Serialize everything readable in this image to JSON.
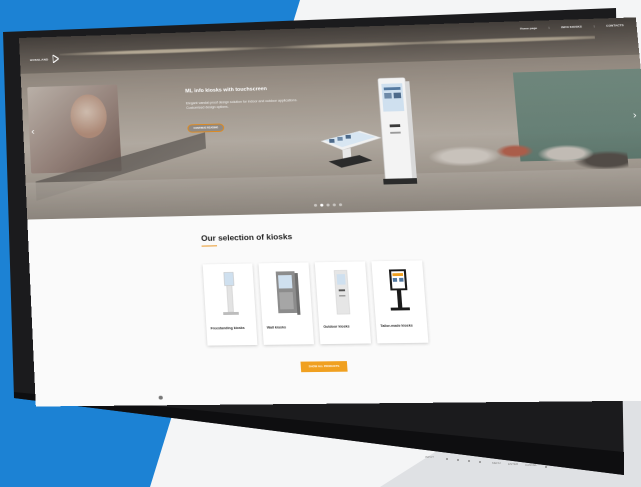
{
  "hero": {
    "logo_text": "HOSSLAND",
    "title": "ML info kiosks with touchscreen",
    "description": "Elegant vandal-proof design solution for indoor and outdoor applications. Customised design options.",
    "cta_label": "CONTINUE READING",
    "slide_count": 5,
    "active_slide": 2
  },
  "nav": {
    "items": [
      {
        "label": "Home page",
        "type": "link"
      },
      {
        "label": "INFO KIOSKS",
        "type": "link"
      },
      {
        "label": "CONTACTS",
        "type": "link"
      }
    ],
    "separator": "|"
  },
  "section": {
    "title": "Our selection of kiosks",
    "cards": [
      {
        "label": "Freestanding kiosks"
      },
      {
        "label": "Wall kiosks"
      },
      {
        "label": "Outdoor kiosks"
      },
      {
        "label": "Tailor-made kiosks"
      }
    ],
    "all_products_label": "SHOW ALL PRODUCTS"
  },
  "bezel": {
    "controls": [
      "INPUT",
      "MENU",
      "ENTER",
      "CANCEL"
    ]
  },
  "colors": {
    "accent": "#f0a020",
    "background_blue": "#1c82d4",
    "bezel": "#1b1b1d"
  },
  "icons": {
    "prev": "chevron-left-icon",
    "next": "chevron-right-icon",
    "logo": "logo-triangle-icon"
  }
}
